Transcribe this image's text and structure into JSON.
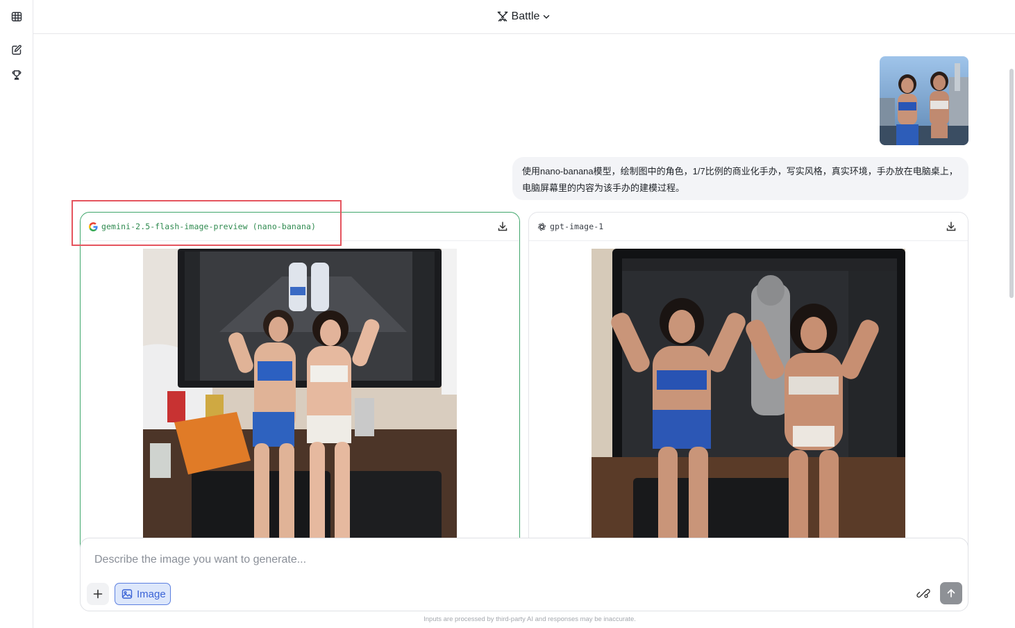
{
  "header": {
    "mode_label": "Battle"
  },
  "sidebar": {
    "items": [
      {
        "icon": "leaderboard-table-icon"
      },
      {
        "icon": "new-chat-icon"
      },
      {
        "icon": "trophy-icon"
      }
    ]
  },
  "conversation": {
    "user_message": "使用nano-banana模型，绘制图中的角色，1/7比例的商业化手办，写实风格，真实环境，手办放在电脑桌上，电脑屏幕里的内容为该手办的建模过程。",
    "responses": [
      {
        "model": "gemini-2.5-flash-image-preview (nano-banana)",
        "provider_icon": "google-icon",
        "selected": true
      },
      {
        "model": "gpt-image-1",
        "provider_icon": "openai-icon",
        "selected": false
      }
    ]
  },
  "composer": {
    "placeholder": "Describe the image you want to generate...",
    "value": "",
    "image_mode_label": "Image"
  },
  "footer": {
    "disclaimer": "Inputs are processed by third-party AI and responses may be inaccurate."
  },
  "colors": {
    "selected_border": "#3fa66b",
    "highlight_box": "#e5545e",
    "image_mode_accent": "#3a63d6"
  }
}
